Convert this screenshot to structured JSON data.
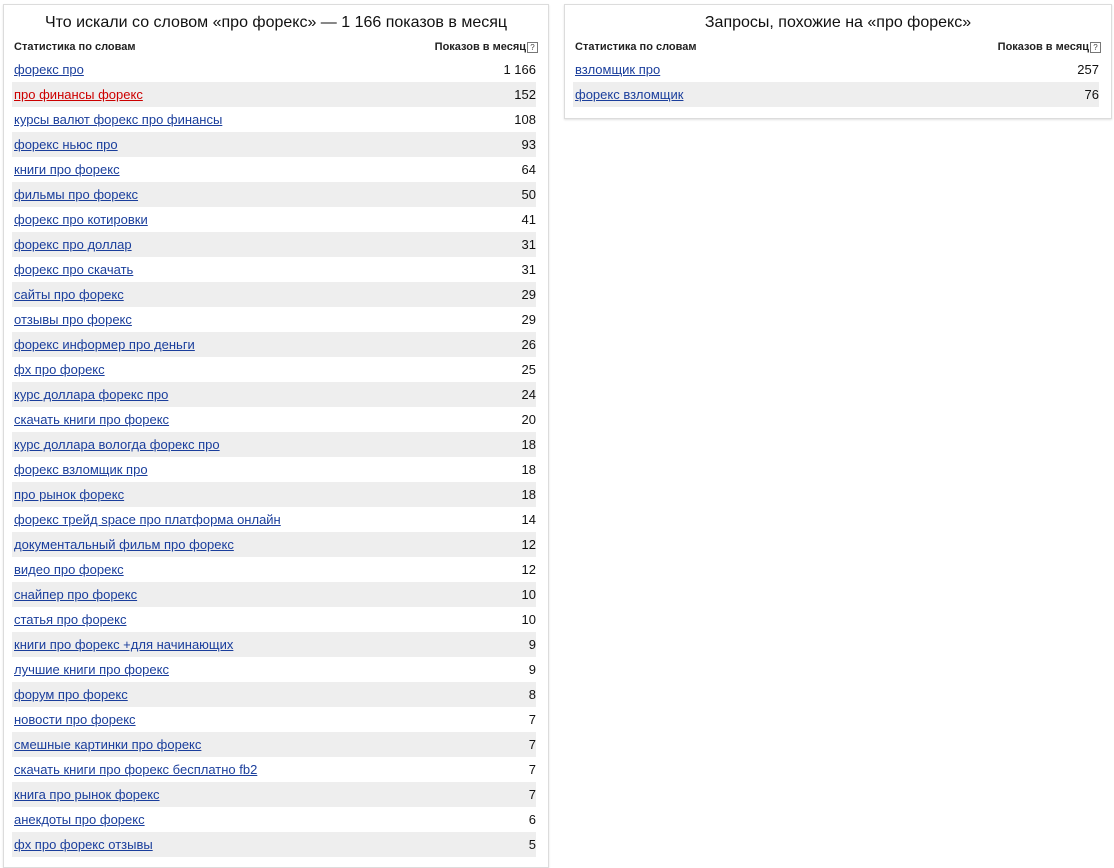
{
  "left_panel": {
    "title": "Что искали со словом «про форекс» — 1 166 показов в месяц",
    "col_keywords": "Статистика по словам",
    "col_impressions": "Показов в месяц",
    "help_icon": "?",
    "rows": [
      {
        "keyword": "форекс про",
        "count": "1 166"
      },
      {
        "keyword": "про финансы форекс",
        "count": "152",
        "visited": true,
        "link_color": "#cc0000"
      },
      {
        "keyword": "курсы валют форекс про финансы",
        "count": "108"
      },
      {
        "keyword": "форекс ньюс про",
        "count": "93"
      },
      {
        "keyword": "книги про форекс",
        "count": "64"
      },
      {
        "keyword": "фильмы про форекс",
        "count": "50"
      },
      {
        "keyword": "форекс про котировки",
        "count": "41"
      },
      {
        "keyword": "форекс про доллар",
        "count": "31"
      },
      {
        "keyword": "форекс про скачать",
        "count": "31"
      },
      {
        "keyword": "сайты про форекс",
        "count": "29"
      },
      {
        "keyword": "отзывы про форекс",
        "count": "29"
      },
      {
        "keyword": "форекс информер про деньги",
        "count": "26"
      },
      {
        "keyword": "фх про форекс",
        "count": "25"
      },
      {
        "keyword": "курс доллара форекс про",
        "count": "24"
      },
      {
        "keyword": "скачать книги про форекс",
        "count": "20"
      },
      {
        "keyword": "курс доллара вологда форекс про",
        "count": "18"
      },
      {
        "keyword": "форекс взломщик про",
        "count": "18"
      },
      {
        "keyword": "про рынок форекс",
        "count": "18"
      },
      {
        "keyword": "форекс трейд space про платформа онлайн",
        "count": "14"
      },
      {
        "keyword": "документальный фильм про форекс",
        "count": "12"
      },
      {
        "keyword": "видео про форекс",
        "count": "12"
      },
      {
        "keyword": "снайпер про форекс",
        "count": "10"
      },
      {
        "keyword": "статья про форекс",
        "count": "10"
      },
      {
        "keyword": "книги про форекс +для начинающих",
        "count": "9"
      },
      {
        "keyword": "лучшие книги про форекс",
        "count": "9"
      },
      {
        "keyword": "форум про форекс",
        "count": "8"
      },
      {
        "keyword": "новости про форекс",
        "count": "7"
      },
      {
        "keyword": "смешные картинки про форекс",
        "count": "7"
      },
      {
        "keyword": "скачать книги про форекс бесплатно fb2",
        "count": "7"
      },
      {
        "keyword": "книга про рынок форекс",
        "count": "7"
      },
      {
        "keyword": "анекдоты про форекс",
        "count": "6"
      },
      {
        "keyword": "фх про форекс отзывы",
        "count": "5"
      }
    ]
  },
  "right_panel": {
    "title": "Запросы, похожие на «про форекс»",
    "col_keywords": "Статистика по словам",
    "col_impressions": "Показов в месяц",
    "help_icon": "?",
    "rows": [
      {
        "keyword": "взломщик про",
        "count": "257"
      },
      {
        "keyword": "форекс взломщик",
        "count": "76"
      }
    ]
  },
  "colors": {
    "link": "#1a3e9c",
    "visited_link": "#cc0000",
    "row_shade": "#eeeeee",
    "panel_border": "#dcdcdc"
  }
}
